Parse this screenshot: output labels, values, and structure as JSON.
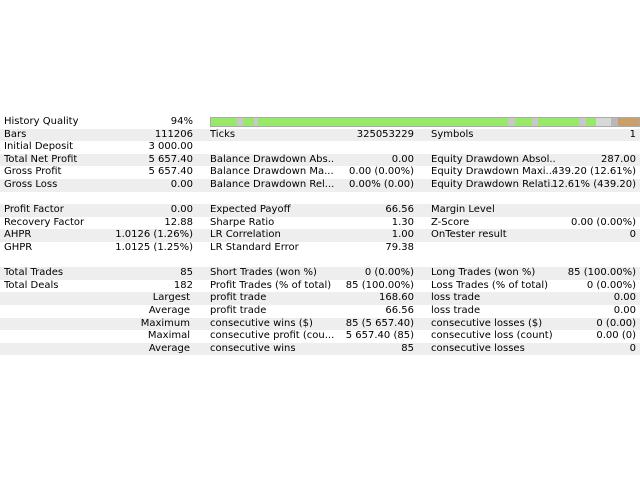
{
  "history_quality": {
    "label": "History Quality",
    "value": "94%",
    "segments": [
      {
        "color": "#98e86a",
        "start": 0.0,
        "end": 0.06
      },
      {
        "color": "#c8c8c8",
        "start": 0.06,
        "end": 0.075
      },
      {
        "color": "#98e86a",
        "start": 0.075,
        "end": 0.1
      },
      {
        "color": "#c8c8c8",
        "start": 0.1,
        "end": 0.11
      },
      {
        "color": "#98e86a",
        "start": 0.11,
        "end": 0.695
      },
      {
        "color": "#c8c8c8",
        "start": 0.695,
        "end": 0.71
      },
      {
        "color": "#98e86a",
        "start": 0.71,
        "end": 0.75
      },
      {
        "color": "#c8c8c8",
        "start": 0.75,
        "end": 0.765
      },
      {
        "color": "#98e86a",
        "start": 0.765,
        "end": 0.86
      },
      {
        "color": "#c8c8c8",
        "start": 0.86,
        "end": 0.875
      },
      {
        "color": "#98e86a",
        "start": 0.875,
        "end": 0.9
      },
      {
        "color": "#d8d8d8",
        "start": 0.9,
        "end": 0.935
      },
      {
        "color": "#b8b8b8",
        "start": 0.935,
        "end": 0.95
      },
      {
        "color": "#c9a06a",
        "start": 0.95,
        "end": 1.0
      }
    ]
  },
  "rows": [
    {
      "shade": true,
      "cells": [
        {
          "t": "Bars"
        },
        {
          "t": "111206"
        },
        {
          "t": "Ticks"
        },
        {
          "t": "325053229"
        },
        {
          "t": "Symbols"
        },
        {
          "t": "1"
        }
      ]
    },
    {
      "shade": false,
      "cells": [
        {
          "t": "Initial Deposit"
        },
        {
          "t": "3 000.00"
        },
        {
          "t": ""
        },
        {
          "t": ""
        },
        {
          "t": ""
        },
        {
          "t": ""
        }
      ]
    },
    {
      "shade": true,
      "cells": [
        {
          "t": "Total Net Profit"
        },
        {
          "t": "5 657.40"
        },
        {
          "t": "Balance Drawdown Abs..."
        },
        {
          "t": "0.00"
        },
        {
          "t": "Equity Drawdown Absol..."
        },
        {
          "t": "287.00"
        }
      ]
    },
    {
      "shade": false,
      "cells": [
        {
          "t": "Gross Profit"
        },
        {
          "t": "5 657.40"
        },
        {
          "t": "Balance Drawdown Ma..."
        },
        {
          "t": "0.00 (0.00%)"
        },
        {
          "t": "Equity Drawdown Maxi..."
        },
        {
          "t": "439.20 (12.61%)"
        }
      ]
    },
    {
      "shade": true,
      "cells": [
        {
          "t": "Gross Loss"
        },
        {
          "t": "0.00"
        },
        {
          "t": "Balance Drawdown Rel..."
        },
        {
          "t": "0.00% (0.00)"
        },
        {
          "t": "Equity Drawdown Relati..."
        },
        {
          "t": "12.61% (439.20)"
        }
      ]
    },
    {
      "gap": true
    },
    {
      "shade": true,
      "cells": [
        {
          "t": "Profit Factor"
        },
        {
          "t": "0.00"
        },
        {
          "t": "Expected Payoff"
        },
        {
          "t": "66.56"
        },
        {
          "t": "Margin Level"
        },
        {
          "t": ""
        }
      ]
    },
    {
      "shade": false,
      "cells": [
        {
          "t": "Recovery Factor"
        },
        {
          "t": "12.88"
        },
        {
          "t": "Sharpe Ratio"
        },
        {
          "t": "1.30"
        },
        {
          "t": "Z-Score"
        },
        {
          "t": "0.00 (0.00%)"
        }
      ]
    },
    {
      "shade": true,
      "cells": [
        {
          "t": "AHPR"
        },
        {
          "t": "1.0126 (1.26%)"
        },
        {
          "t": "LR Correlation"
        },
        {
          "t": "1.00"
        },
        {
          "t": "OnTester result"
        },
        {
          "t": "0"
        }
      ]
    },
    {
      "shade": false,
      "cells": [
        {
          "t": "GHPR"
        },
        {
          "t": "1.0125 (1.25%)"
        },
        {
          "t": "LR Standard Error"
        },
        {
          "t": "79.38"
        },
        {
          "t": ""
        },
        {
          "t": ""
        }
      ]
    },
    {
      "gap": true
    },
    {
      "shade": true,
      "cells": [
        {
          "t": "Total Trades"
        },
        {
          "t": "85"
        },
        {
          "t": "Short Trades (won %)"
        },
        {
          "t": "0 (0.00%)"
        },
        {
          "t": "Long Trades (won %)"
        },
        {
          "t": "85 (100.00%)"
        }
      ]
    },
    {
      "shade": false,
      "cells": [
        {
          "t": "Total Deals"
        },
        {
          "t": "182"
        },
        {
          "t": "Profit Trades (% of total)"
        },
        {
          "t": "85 (100.00%)"
        },
        {
          "t": "Loss Trades (% of total)"
        },
        {
          "t": "0 (0.00%)"
        }
      ]
    },
    {
      "shade": true,
      "right0": true,
      "cells": [
        {
          "t": "Largest"
        },
        {
          "t": ""
        },
        {
          "t": "profit trade"
        },
        {
          "t": "168.60"
        },
        {
          "t": "loss trade"
        },
        {
          "t": "0.00"
        }
      ]
    },
    {
      "shade": false,
      "right0": true,
      "cells": [
        {
          "t": "Average"
        },
        {
          "t": ""
        },
        {
          "t": "profit trade"
        },
        {
          "t": "66.56"
        },
        {
          "t": "loss trade"
        },
        {
          "t": "0.00"
        }
      ]
    },
    {
      "shade": true,
      "right0": true,
      "cells": [
        {
          "t": "Maximum"
        },
        {
          "t": ""
        },
        {
          "t": "consecutive wins ($)"
        },
        {
          "t": "85 (5 657.40)"
        },
        {
          "t": "consecutive losses ($)"
        },
        {
          "t": "0 (0.00)"
        }
      ]
    },
    {
      "shade": false,
      "right0": true,
      "cells": [
        {
          "t": "Maximal"
        },
        {
          "t": ""
        },
        {
          "t": "consecutive profit (cou..."
        },
        {
          "t": "5 657.40 (85)"
        },
        {
          "t": "consecutive loss (count)"
        },
        {
          "t": "0.00 (0)"
        }
      ]
    },
    {
      "shade": true,
      "right0": true,
      "cells": [
        {
          "t": "Average"
        },
        {
          "t": ""
        },
        {
          "t": "consecutive wins"
        },
        {
          "t": "85"
        },
        {
          "t": "consecutive losses"
        },
        {
          "t": "0"
        }
      ]
    }
  ]
}
